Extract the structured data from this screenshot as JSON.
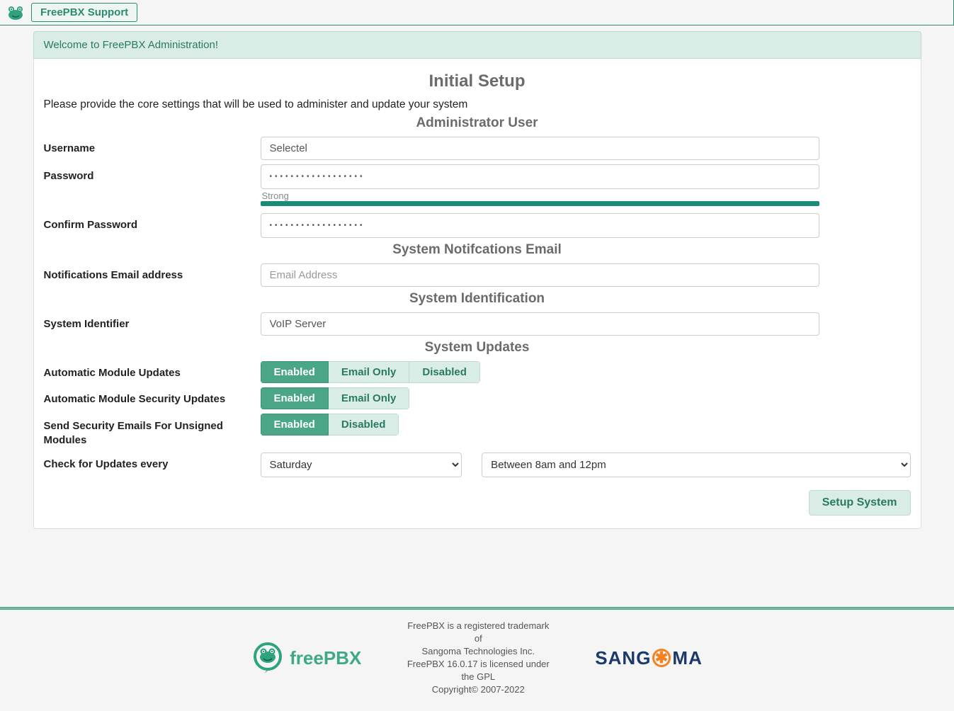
{
  "topbar": {
    "support_label": "FreePBX Support"
  },
  "welcome": "Welcome to FreePBX Administration!",
  "page_title": "Initial Setup",
  "intro": "Please provide the core settings that will be used to administer and update your system",
  "sections": {
    "admin_user": "Administrator User",
    "notif_email": "System Notifcations Email",
    "sys_ident": "System Identification",
    "sys_updates": "System Updates"
  },
  "labels": {
    "username": "Username",
    "password": "Password",
    "confirm_password": "Confirm Password",
    "notif_email": "Notifications Email address",
    "sys_identifier": "System Identifier",
    "auto_module_updates": "Automatic Module Updates",
    "auto_module_sec_updates": "Automatic Module Security Updates",
    "send_sec_emails": "Send Security Emails For Unsigned Modules",
    "check_updates_every": "Check for Updates every"
  },
  "values": {
    "username": "Selectel",
    "password": "••••••••••••••••••",
    "confirm_password": "••••••••••••••••••",
    "strength_label": "Strong",
    "notif_email_placeholder": "Email Address",
    "sys_identifier": "VoIP Server",
    "check_day": "Saturday",
    "check_time": "Between 8am and 12pm"
  },
  "toggles": {
    "enabled": "Enabled",
    "email_only": "Email Only",
    "disabled": "Disabled"
  },
  "actions": {
    "setup_system": "Setup System"
  },
  "footer": {
    "line1": "FreePBX is a registered trademark of",
    "line2": "Sangoma Technologies Inc.",
    "line3": "FreePBX 16.0.17 is licensed under the GPL",
    "line4": "Copyright© 2007-2022",
    "freepbx_text": "freePBX",
    "sangoma_pre": "SANG",
    "sangoma_post": "MA"
  }
}
